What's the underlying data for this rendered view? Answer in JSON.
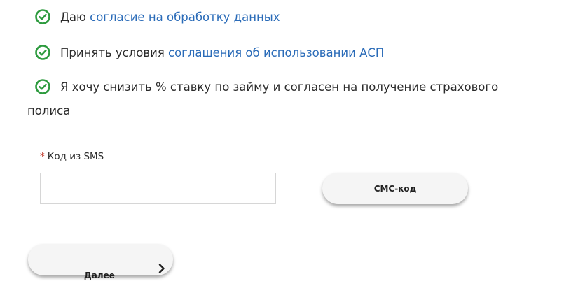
{
  "consents": [
    {
      "prefix": "Даю ",
      "link": "согласие на обработку данных",
      "suffix": "",
      "checked": true
    },
    {
      "prefix": "Принять условия ",
      "link": "соглашения об использовании АСП",
      "suffix": "",
      "checked": true
    },
    {
      "prefix": "Я хочу снизить % ставку по займу и согласен на получение страхового",
      "link": "",
      "suffix": "полиса",
      "checked": true
    }
  ],
  "sms": {
    "required_mark": "*",
    "label": "Код из SMS",
    "value": "",
    "button_label": "СМС-код"
  },
  "next_button": {
    "label": "Далее"
  },
  "colors": {
    "check": "#2e9b3f",
    "link": "#2a6bb8",
    "required": "#c0392b"
  },
  "icons": {
    "check": "check-circle-icon",
    "next": "chevron-right-icon"
  }
}
